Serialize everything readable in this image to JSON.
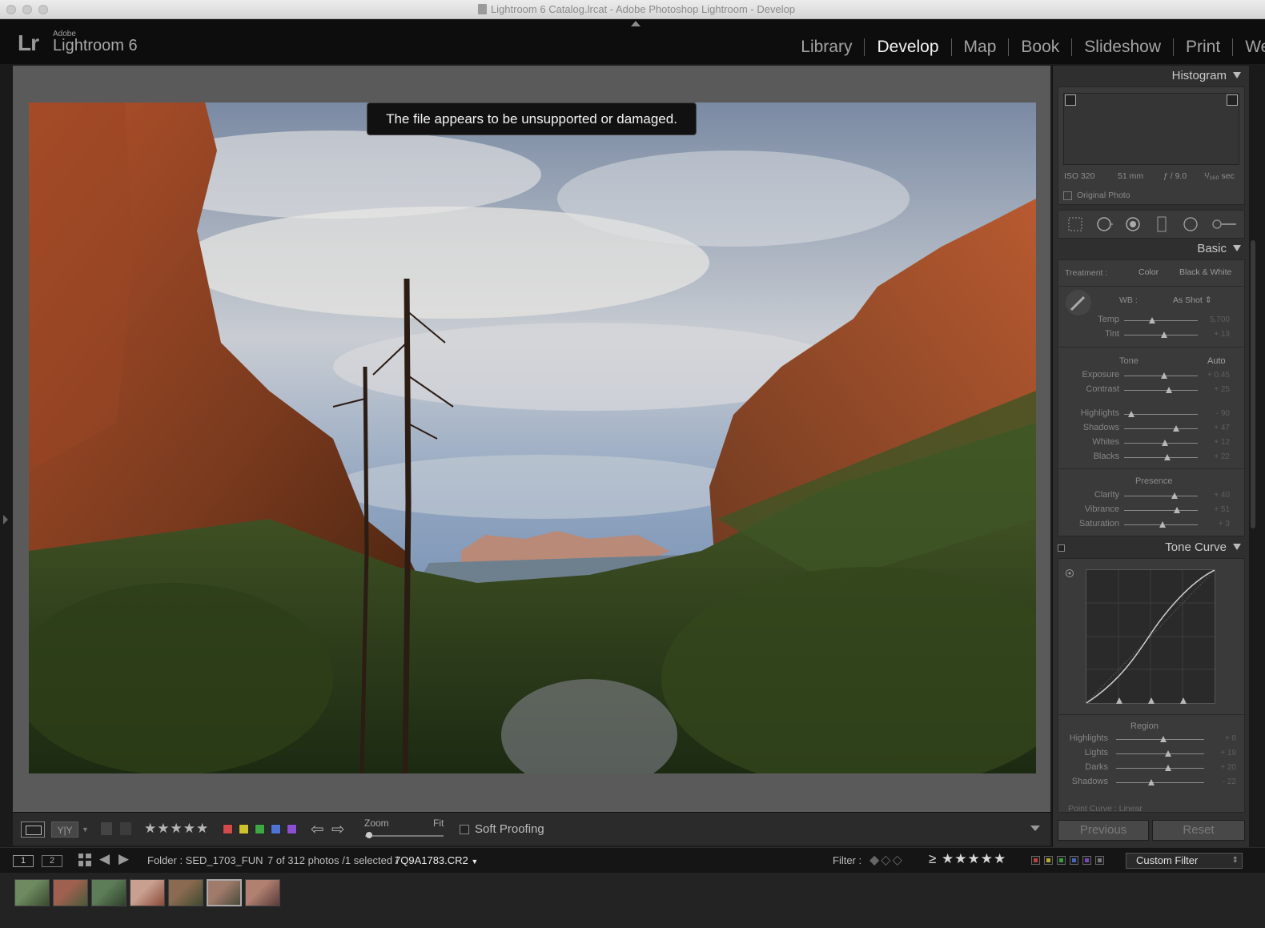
{
  "window": {
    "title": "Lightroom 6 Catalog.lrcat - Adobe Photoshop Lightroom - Develop"
  },
  "identity": {
    "logo": "Lr",
    "adobe": "Adobe",
    "product": "Lightroom 6"
  },
  "modules": [
    "Library",
    "Develop",
    "Map",
    "Book",
    "Slideshow",
    "Print",
    "Web"
  ],
  "active_module": "Develop",
  "center": {
    "toast": "The file appears to be unsupported or damaged."
  },
  "toolbar": {
    "compare_label": "Y|Y",
    "stars": "★★★★★",
    "color_labels": [
      "#d24a4a",
      "#cdc22e",
      "#3ea944",
      "#4e74d5",
      "#8a4fd2"
    ],
    "zoom_label": "Zoom",
    "zoom_value": "Fit",
    "soft_proofing": "Soft Proofing"
  },
  "histogram": {
    "title": "Histogram",
    "iso": "ISO 320",
    "focal": "51 mm",
    "aperture": "ƒ / 9.0",
    "shutter": "¹/₁₆₀ sec",
    "original_photo": "Original Photo"
  },
  "basic": {
    "title": "Basic",
    "treatment_label": "Treatment :",
    "treatment_color": "Color",
    "treatment_bw": "Black & White",
    "wb_label": "WB :",
    "wb_value": "As Shot",
    "tone_label": "Tone",
    "auto_label": "Auto",
    "presence_label": "Presence",
    "wb_sliders": [
      {
        "name": "Temp",
        "value": "5,700",
        "pos": 0.38
      },
      {
        "name": "Tint",
        "value": "+ 13",
        "pos": 0.54
      }
    ],
    "tone_sliders": [
      {
        "name": "Exposure",
        "value": "+ 0.45",
        "pos": 0.54
      },
      {
        "name": "Contrast",
        "value": "+ 25",
        "pos": 0.61
      }
    ],
    "tone_sliders2": [
      {
        "name": "Highlights",
        "value": "- 90",
        "pos": 0.1
      },
      {
        "name": "Shadows",
        "value": "+ 47",
        "pos": 0.71
      },
      {
        "name": "Whites",
        "value": "+ 12",
        "pos": 0.55
      },
      {
        "name": "Blacks",
        "value": "+ 22",
        "pos": 0.59
      }
    ],
    "presence_sliders": [
      {
        "name": "Clarity",
        "value": "+ 40",
        "pos": 0.68
      },
      {
        "name": "Vibrance",
        "value": "+ 51",
        "pos": 0.72
      },
      {
        "name": "Saturation",
        "value": "+ 3",
        "pos": 0.52
      }
    ]
  },
  "tone_curve": {
    "title": "Tone Curve",
    "region_label": "Region",
    "sliders": [
      {
        "name": "Highlights",
        "value": "+ 8",
        "pos": 0.54
      },
      {
        "name": "Lights",
        "value": "+ 19",
        "pos": 0.59
      },
      {
        "name": "Darks",
        "value": "+ 20",
        "pos": 0.59
      },
      {
        "name": "Shadows",
        "value": "- 22",
        "pos": 0.4
      }
    ],
    "point_curve": "Point Curve :  Linear"
  },
  "buttons": {
    "previous": "Previous",
    "reset": "Reset"
  },
  "filmstrip": {
    "monitor1": "1",
    "monitor2": "2",
    "source": "Folder : SED_1703_FUN",
    "count": "7 of 312 photos /1 selected /",
    "file": "7Q9A1783.CR2",
    "filter_label": "Filter :",
    "stars": "≥ ★★★★★",
    "filter_preset": "Custom Filter",
    "color_filters": [
      "#c04040",
      "#b8ad2a",
      "#38a03c",
      "#4466c0",
      "#7c45c0",
      "#777777"
    ],
    "thumbs": [
      {
        "c1": "#6d8a60",
        "c2": "#3a4a30"
      },
      {
        "c1": "#a06050",
        "c2": "#4a5a3a"
      },
      {
        "c1": "#5d7d58",
        "c2": "#2f3f2a"
      },
      {
        "c1": "#c9a090",
        "c2": "#8a4a3a"
      },
      {
        "c1": "#8a6a50",
        "c2": "#3f4a30"
      },
      {
        "c1": "#a07a6a",
        "c2": "#4a4a3a"
      },
      {
        "c1": "#b08070",
        "c2": "#5a3a3a"
      }
    ],
    "selected_index": 5
  }
}
